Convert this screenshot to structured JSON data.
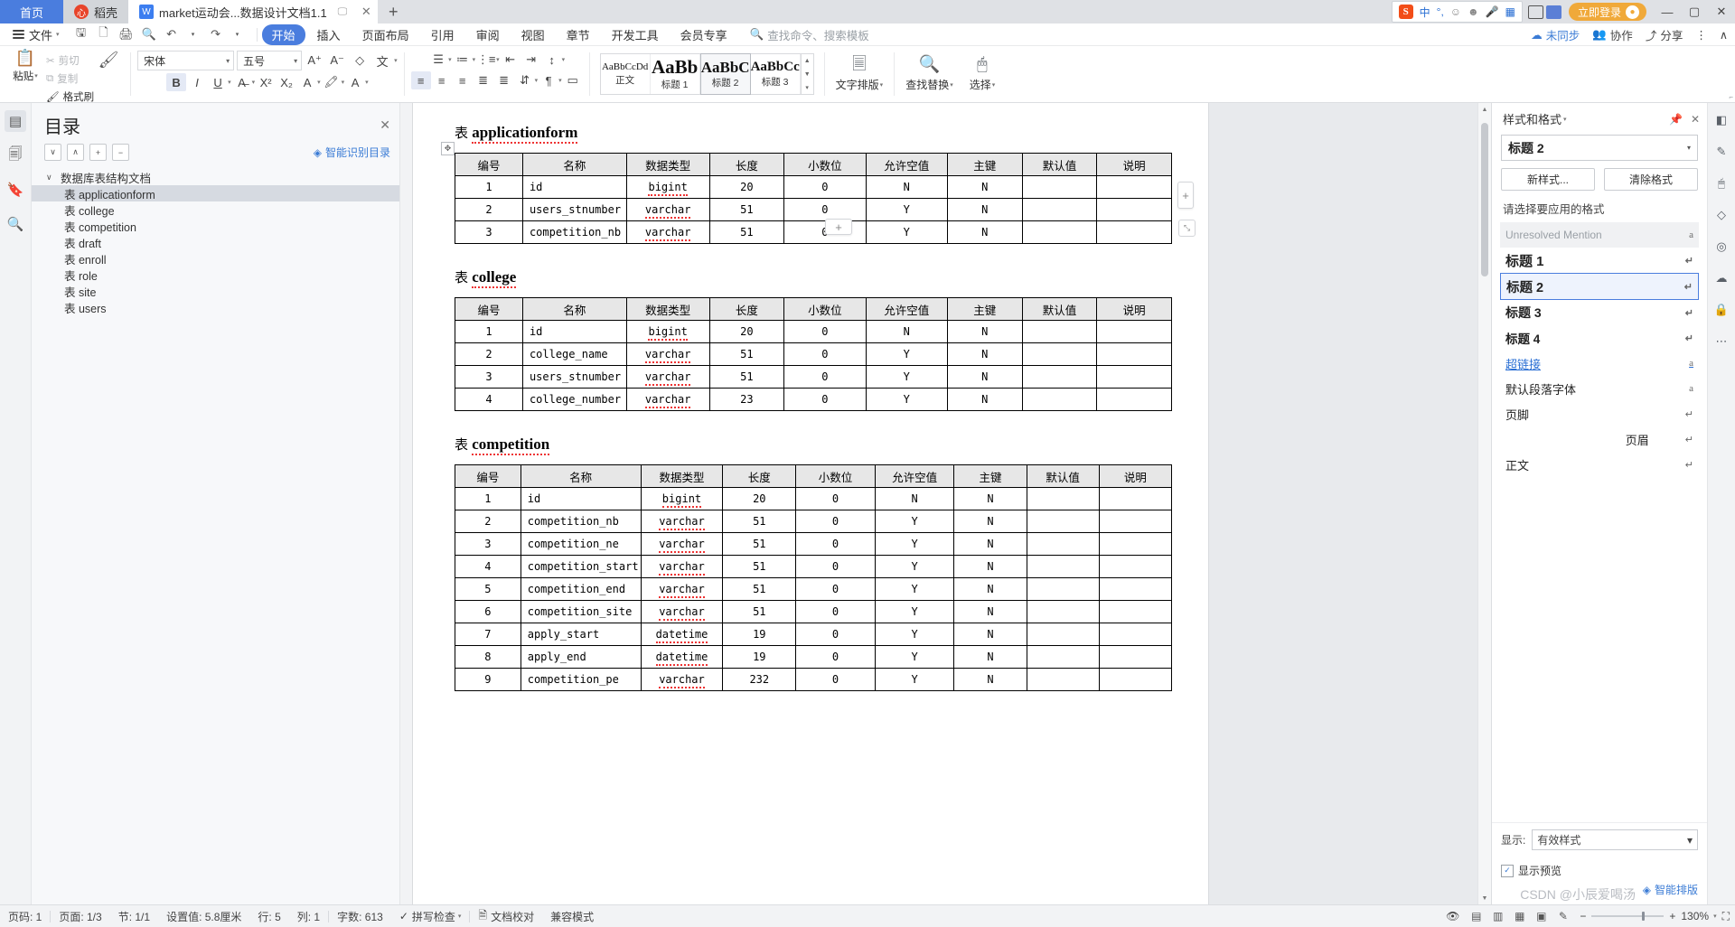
{
  "window": {
    "tabs": [
      {
        "label": "首页",
        "type": "home"
      },
      {
        "label": "稻壳",
        "type": "docer"
      },
      {
        "label": "market运动会...数据设计文档1.1",
        "type": "doc"
      }
    ],
    "new_tab": "+",
    "ime": {
      "brand": "S",
      "mode": "中",
      "punct": "°,",
      "emoji": "☺",
      "img": "▣",
      "mic": "🎤",
      "kb": "⌨"
    },
    "login_label": "立即登录",
    "win_min": "—",
    "win_max": "▢",
    "win_close": "✕"
  },
  "menu": {
    "file_label": "文件",
    "quick_icons": [
      "save-icon",
      "print-preview-icon",
      "print-icon",
      "find-icon",
      "undo-icon",
      "redo-icon",
      "more-icon"
    ],
    "tabs": [
      "开始",
      "插入",
      "页面布局",
      "引用",
      "审阅",
      "视图",
      "章节",
      "开发工具",
      "会员专享"
    ],
    "active_tab": "开始",
    "search_placeholder": "查找命令、搜索模板",
    "right": [
      {
        "label": "未同步",
        "icon": "cloud-icon"
      },
      {
        "label": "协作",
        "icon": "people-icon"
      },
      {
        "label": "分享",
        "icon": "share-icon"
      },
      {
        "label": "⋮",
        "icon": "more-vertical-icon"
      },
      {
        "label": "∧",
        "icon": "collapse-ribbon-icon"
      }
    ]
  },
  "ribbon": {
    "paste_label": "粘贴",
    "cut_label": "剪切",
    "copy_label": "复制",
    "format_painter_label": "格式刷",
    "font_name": "宋体",
    "font_size": "五号",
    "styles": [
      {
        "preview": "AaBbCcDd",
        "label": "正文",
        "size": "11px",
        "selected": false
      },
      {
        "preview": "AaBb",
        "label": "标题 1",
        "size": "22px",
        "selected": false
      },
      {
        "preview": "AaBbC",
        "label": "标题 2",
        "size": "18px",
        "selected": true
      },
      {
        "preview": "AaBbCc",
        "label": "标题 3",
        "size": "15px",
        "selected": false
      }
    ],
    "text_layout_label": "文字排版",
    "find_replace_label": "查找替换",
    "select_label": "选择"
  },
  "nav_pane": {
    "title": "目录",
    "smart_label": "智能识别目录",
    "close": "✕",
    "tools": [
      "∨",
      "∧",
      "+",
      "−"
    ],
    "items": [
      {
        "label": "数据库表结构文档",
        "level": 0,
        "selected": false
      },
      {
        "label": "表 applicationform",
        "level": 1,
        "selected": true
      },
      {
        "label": "表 college",
        "level": 1,
        "selected": false
      },
      {
        "label": "表 competition",
        "level": 1,
        "selected": false
      },
      {
        "label": "表 draft",
        "level": 1,
        "selected": false
      },
      {
        "label": "表 enroll",
        "level": 1,
        "selected": false
      },
      {
        "label": "表 role",
        "level": 1,
        "selected": false
      },
      {
        "label": "表 site",
        "level": 1,
        "selected": false
      },
      {
        "label": "表 users",
        "level": 1,
        "selected": false
      }
    ]
  },
  "document": {
    "columns": [
      "编号",
      "名称",
      "数据类型",
      "长度",
      "小数位",
      "允许空值",
      "主键",
      "默认值",
      "说明"
    ],
    "tables": [
      {
        "title_prefix": "表",
        "title": "applicationform",
        "rows": [
          [
            "1",
            "id",
            "bigint",
            "20",
            "0",
            "N",
            "N",
            "",
            ""
          ],
          [
            "2",
            "users_stnumber",
            "varchar",
            "51",
            "0",
            "Y",
            "N",
            "",
            ""
          ],
          [
            "3",
            "competition_nb",
            "varchar",
            "51",
            "0",
            "Y",
            "N",
            "",
            ""
          ]
        ]
      },
      {
        "title_prefix": "表",
        "title": "college",
        "rows": [
          [
            "1",
            "id",
            "bigint",
            "20",
            "0",
            "N",
            "N",
            "",
            ""
          ],
          [
            "2",
            "college_name",
            "varchar",
            "51",
            "0",
            "Y",
            "N",
            "",
            ""
          ],
          [
            "3",
            "users_stnumber",
            "varchar",
            "51",
            "0",
            "Y",
            "N",
            "",
            ""
          ],
          [
            "4",
            "college_number",
            "varchar",
            "23",
            "0",
            "Y",
            "N",
            "",
            ""
          ]
        ]
      },
      {
        "title_prefix": "表",
        "title": "competition",
        "rows": [
          [
            "1",
            "id",
            "bigint",
            "20",
            "0",
            "N",
            "N",
            "",
            ""
          ],
          [
            "2",
            "competition_nb",
            "varchar",
            "51",
            "0",
            "Y",
            "N",
            "",
            ""
          ],
          [
            "3",
            "competition_ne",
            "varchar",
            "51",
            "0",
            "Y",
            "N",
            "",
            ""
          ],
          [
            "4",
            "competition_start",
            "varchar",
            "51",
            "0",
            "Y",
            "N",
            "",
            ""
          ],
          [
            "5",
            "competition_end",
            "varchar",
            "51",
            "0",
            "Y",
            "N",
            "",
            ""
          ],
          [
            "6",
            "competition_site",
            "varchar",
            "51",
            "0",
            "Y",
            "N",
            "",
            ""
          ],
          [
            "7",
            "apply_start",
            "datetime",
            "19",
            "0",
            "Y",
            "N",
            "",
            ""
          ],
          [
            "8",
            "apply_end",
            "datetime",
            "19",
            "0",
            "Y",
            "N",
            "",
            ""
          ],
          [
            "9",
            "competition_pe",
            "varchar",
            "232",
            "0",
            "Y",
            "N",
            "",
            ""
          ]
        ]
      }
    ]
  },
  "styles_panel": {
    "title": "样式和格式",
    "pin": "📌",
    "close": "✕",
    "current_style": "标题 2",
    "new_style_btn": "新样式...",
    "clear_format_btn": "清除格式",
    "pick_label": "请选择要应用的格式",
    "items": [
      {
        "label": "Unresolved Mention",
        "kind": "gray",
        "mark": "a"
      },
      {
        "label": "标题 1",
        "kind": "h1",
        "mark": "↵"
      },
      {
        "label": "标题 2",
        "kind": "h2",
        "mark": "↵",
        "selected": true
      },
      {
        "label": "标题 3",
        "kind": "h3",
        "mark": "↵"
      },
      {
        "label": "标题 4",
        "kind": "h4",
        "mark": "↵"
      },
      {
        "label": "超链接",
        "kind": "link",
        "mark": "a"
      },
      {
        "label": "默认段落字体",
        "kind": "plain",
        "mark": "a"
      },
      {
        "label": "页脚",
        "kind": "plain",
        "mark": "↵"
      },
      {
        "label": "页眉",
        "kind": "right",
        "mark": "↵"
      },
      {
        "label": "正文",
        "kind": "plain",
        "mark": "↵"
      }
    ],
    "show_label": "显示:",
    "show_value": "有效样式",
    "preview_label": "显示预览",
    "smart_label": "智能排版"
  },
  "status_bar": {
    "page_no": "页码: 1",
    "pages": "页面: 1/3",
    "section": "节: 1/1",
    "position": "设置值: 5.8厘米",
    "line": "行: 5",
    "col": "列: 1",
    "words": "字数: 613",
    "spellcheck": "拼写检查",
    "proof": "文档校对",
    "compat": "兼容模式",
    "zoom": "130%",
    "zoom_minus": "−",
    "zoom_plus": "+",
    "full": "⛶"
  },
  "watermark": "CSDN @小辰爱喝汤"
}
